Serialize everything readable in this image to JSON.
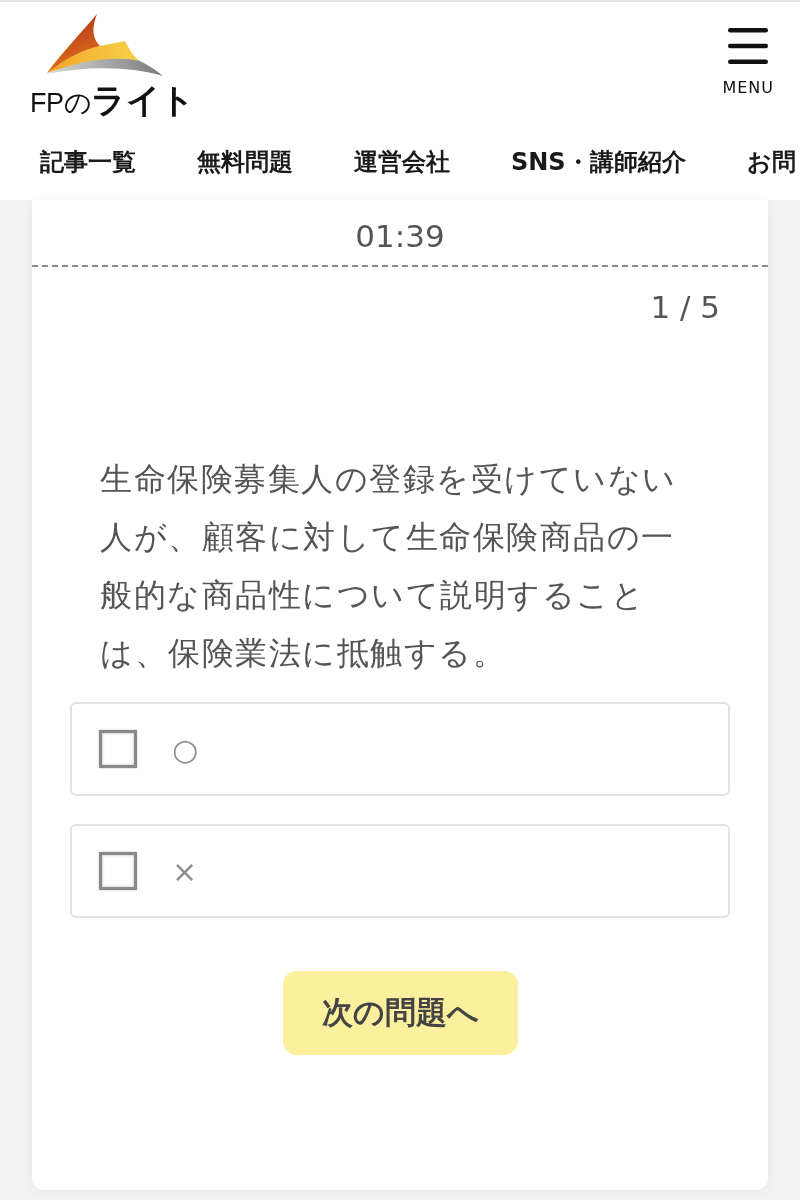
{
  "header": {
    "logo_text": "FPの**ライト**",
    "menu_label": "MENU"
  },
  "nav": {
    "items": [
      {
        "label": "記事一覧"
      },
      {
        "label": "無料問題"
      },
      {
        "label": "運営会社"
      },
      {
        "label": "SNS・講師紹介"
      },
      {
        "label": "お問"
      }
    ]
  },
  "quiz": {
    "timer": "01:39",
    "progress": "1 / 5",
    "question": "生命保険募集人の登録を受けていない人が、顧客に対して生命保険商品の一般的な商品性について説明することは、保険業法に抵触する。",
    "options": [
      {
        "label": "○",
        "checked": false
      },
      {
        "label": "×",
        "checked": false
      }
    ],
    "next_button": "次の問題へ"
  }
}
